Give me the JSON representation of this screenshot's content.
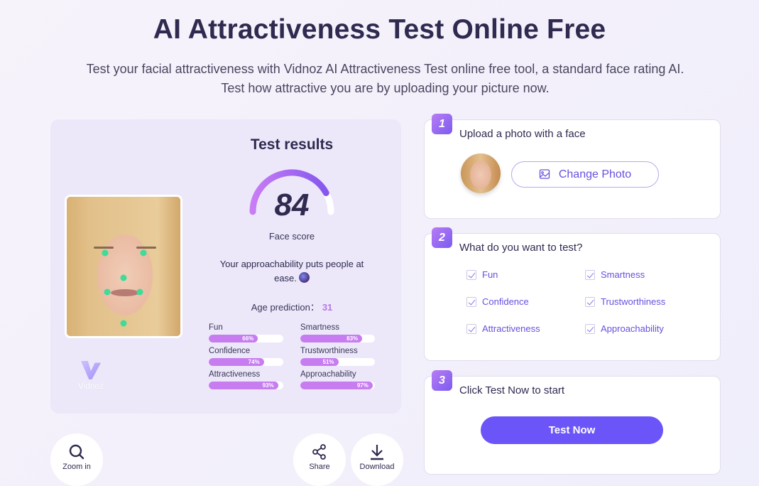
{
  "header": {
    "title": "AI Attractiveness Test Online Free",
    "subtitle_line1": "Test your facial attractiveness with Vidnoz AI Attractiveness Test online free tool, a standard face rating AI.",
    "subtitle_line2": "Test how attractive you are by uploading your picture now."
  },
  "results": {
    "title": "Test results",
    "face_score": "84",
    "face_score_value": 84,
    "face_score_max": 100,
    "face_score_label": "Face score",
    "description": "Your approachability puts people at ease.",
    "age_label": "Age prediction：",
    "age_value": "31",
    "brand_name": "Vidnoz",
    "metrics": [
      {
        "label": "Fun",
        "value": 66,
        "text": "66%"
      },
      {
        "label": "Smartness",
        "value": 83,
        "text": "83%"
      },
      {
        "label": "Confidence",
        "value": 74,
        "text": "74%"
      },
      {
        "label": "Trustworthiness",
        "value": 51,
        "text": "51%"
      },
      {
        "label": "Attractiveness",
        "value": 93,
        "text": "93%"
      },
      {
        "label": "Approachability",
        "value": 97,
        "text": "97%"
      }
    ],
    "colors": {
      "bar": "#c77cf0",
      "age": "#b477e8",
      "landmark": "#3ddc97"
    }
  },
  "actions": {
    "zoom_in": "Zoom in",
    "share": "Share",
    "download": "Download"
  },
  "steps": [
    {
      "number": "1",
      "title": "Upload a photo with a face",
      "button": "Change Photo"
    },
    {
      "number": "2",
      "title": "What do you want to test?",
      "options": [
        {
          "label": "Fun",
          "checked": true
        },
        {
          "label": "Smartness",
          "checked": true
        },
        {
          "label": "Confidence",
          "checked": true
        },
        {
          "label": "Trustworthiness",
          "checked": true
        },
        {
          "label": "Attractiveness",
          "checked": true
        },
        {
          "label": "Approachability",
          "checked": true
        }
      ]
    },
    {
      "number": "3",
      "title": "Click Test Now to start",
      "button": "Test Now"
    }
  ],
  "accent_color": "#6c55f8"
}
